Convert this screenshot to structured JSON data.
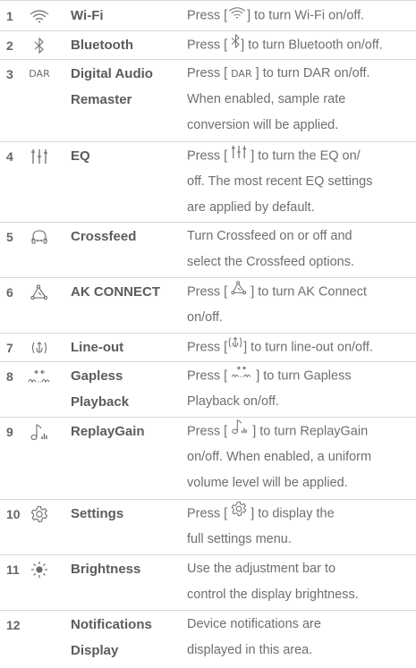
{
  "rows": [
    {
      "num": "1",
      "icon": "wifi-icon",
      "name": "Wi-Fi",
      "desc_pre": "Press [",
      "desc_post": "] to turn Wi-Fi on/off."
    },
    {
      "num": "2",
      "icon": "bluetooth-icon",
      "name": "Bluetooth",
      "desc_pre": "Press [",
      "desc_post": "] to turn Bluetooth on/off."
    },
    {
      "num": "3",
      "icon": "dar-icon",
      "icon_text": "DAR",
      "name_l1": "Digital Audio",
      "name_l2": "Remaster",
      "desc_pre": "Press [",
      "desc_post": "] to turn DAR on/off.",
      "desc_l2": "When enabled, sample rate",
      "desc_l3": "conversion will be applied."
    },
    {
      "num": "4",
      "icon": "eq-icon",
      "name": "EQ",
      "desc_pre": "Press [",
      "desc_post": "] to turn the EQ on/",
      "desc_l2": "off. The most recent EQ settings",
      "desc_l3": "are applied by default."
    },
    {
      "num": "5",
      "icon": "crossfeed-icon",
      "name": "Crossfeed",
      "desc_l1": "Turn Crossfeed on or off and",
      "desc_l2": "select the Crossfeed options."
    },
    {
      "num": "6",
      "icon": "ak-connect-icon",
      "name": "AK CONNECT",
      "desc_pre": "Press [",
      "desc_post": "] to turn AK Connect",
      "desc_l2": "on/off."
    },
    {
      "num": "7",
      "icon": "line-out-icon",
      "name": "Line-out",
      "desc_pre": "Press [",
      "desc_post": "] to turn line-out on/off."
    },
    {
      "num": "8",
      "icon": "gapless-icon",
      "name_l1": "Gapless",
      "name_l2": "Playback",
      "desc_pre": "Press [",
      "desc_post": "] to turn Gapless",
      "desc_l2": "Playback on/off."
    },
    {
      "num": "9",
      "icon": "replaygain-icon",
      "name": "ReplayGain",
      "desc_pre": "Press [",
      "desc_post": "] to turn ReplayGain",
      "desc_l2": "on/off. When enabled, a uniform",
      "desc_l3": "volume level will be applied."
    },
    {
      "num": "10",
      "icon": "settings-icon",
      "name": "Settings",
      "desc_pre": "Press [",
      "desc_post": "] to display the",
      "desc_l2": "full settings menu."
    },
    {
      "num": "11",
      "icon": "brightness-icon",
      "name": "Brightness",
      "desc_l1": "Use the adjustment bar to",
      "desc_l2": "control the display brightness."
    },
    {
      "num": "12",
      "icon": "",
      "name_l1": "Notifications",
      "name_l2": "Display",
      "desc_l1": "Device notifications are",
      "desc_l2": "displayed in this area."
    }
  ]
}
